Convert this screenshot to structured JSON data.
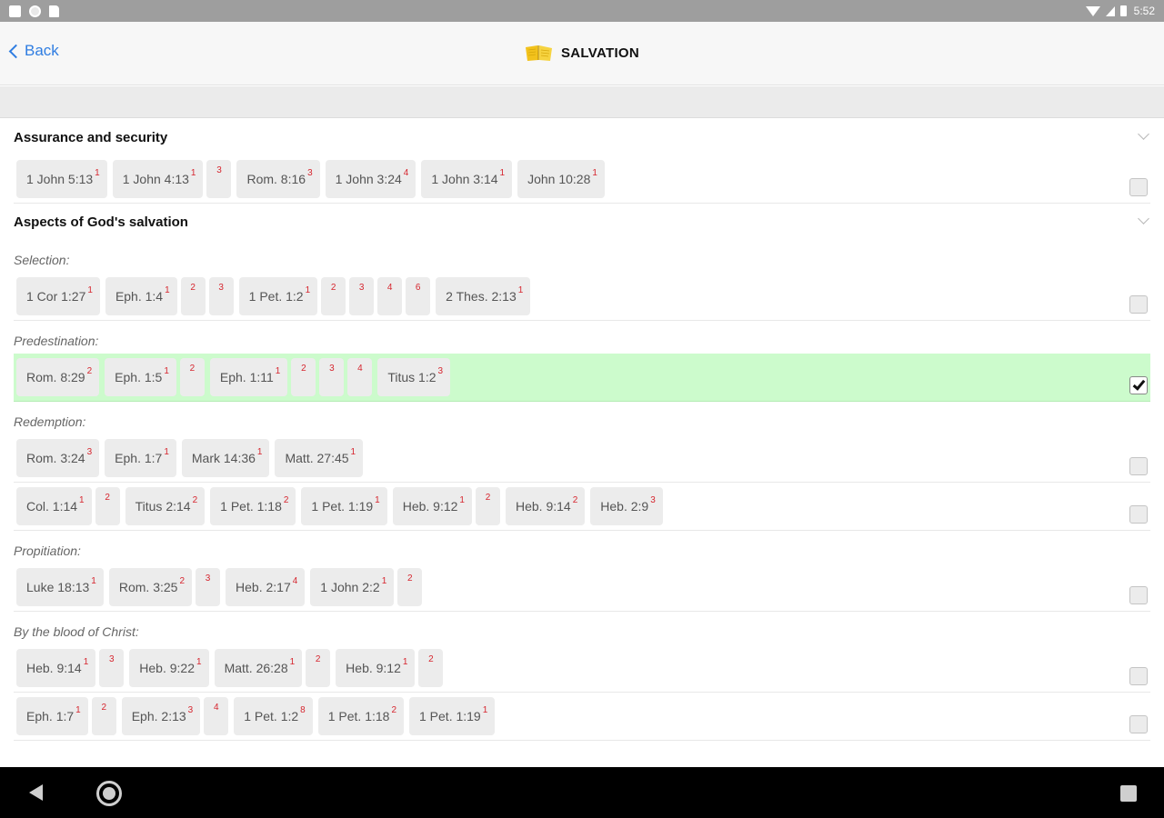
{
  "status_bar": {
    "time": "5:52"
  },
  "header": {
    "back_label": "Back",
    "title": "SALVATION"
  },
  "sections": [
    {
      "title": "Assurance and security",
      "groups": [
        {
          "label": "",
          "rows": [
            {
              "selected": false,
              "refs": [
                {
                  "ref": "1 John 5:13",
                  "sups": [
                    "1"
                  ]
                },
                {
                  "ref": "1 John 4:13",
                  "sups": [
                    "1",
                    "3"
                  ]
                },
                {
                  "ref": "Rom. 8:16",
                  "sups": [
                    "3"
                  ]
                },
                {
                  "ref": "1 John 3:24",
                  "sups": [
                    "4"
                  ]
                },
                {
                  "ref": "1 John 3:14",
                  "sups": [
                    "1"
                  ]
                },
                {
                  "ref": "John 10:28",
                  "sups": [
                    "1"
                  ]
                }
              ]
            }
          ]
        }
      ]
    },
    {
      "title": "Aspects of God's salvation",
      "groups": [
        {
          "label": "Selection:",
          "rows": [
            {
              "selected": false,
              "refs": [
                {
                  "ref": "1 Cor 1:27",
                  "sups": [
                    "1"
                  ]
                },
                {
                  "ref": "Eph. 1:4",
                  "sups": [
                    "1",
                    "2",
                    "3"
                  ]
                },
                {
                  "ref": "1 Pet. 1:2",
                  "sups": [
                    "1",
                    "2",
                    "3",
                    "4",
                    "6"
                  ]
                },
                {
                  "ref": "2 Thes. 2:13",
                  "sups": [
                    "1"
                  ]
                }
              ]
            }
          ]
        },
        {
          "label": "Predestination:",
          "rows": [
            {
              "selected": true,
              "refs": [
                {
                  "ref": "Rom. 8:29",
                  "sups": [
                    "2"
                  ]
                },
                {
                  "ref": "Eph. 1:5",
                  "sups": [
                    "1",
                    "2"
                  ]
                },
                {
                  "ref": "Eph. 1:11",
                  "sups": [
                    "1",
                    "2",
                    "3",
                    "4"
                  ]
                },
                {
                  "ref": "Titus 1:2",
                  "sups": [
                    "3"
                  ]
                }
              ]
            }
          ]
        },
        {
          "label": "Redemption:",
          "rows": [
            {
              "selected": false,
              "refs": [
                {
                  "ref": "Rom. 3:24",
                  "sups": [
                    "3"
                  ]
                },
                {
                  "ref": "Eph. 1:7",
                  "sups": [
                    "1"
                  ]
                },
                {
                  "ref": "Mark 14:36",
                  "sups": [
                    "1"
                  ]
                },
                {
                  "ref": "Matt. 27:45",
                  "sups": [
                    "1"
                  ]
                }
              ]
            },
            {
              "selected": false,
              "refs": [
                {
                  "ref": "Col. 1:14",
                  "sups": [
                    "1",
                    "2"
                  ]
                },
                {
                  "ref": "Titus 2:14",
                  "sups": [
                    "2"
                  ]
                },
                {
                  "ref": "1 Pet. 1:18",
                  "sups": [
                    "2"
                  ]
                },
                {
                  "ref": "1 Pet. 1:19",
                  "sups": [
                    "1"
                  ]
                },
                {
                  "ref": "Heb. 9:12",
                  "sups": [
                    "1",
                    "2"
                  ]
                },
                {
                  "ref": "Heb. 9:14",
                  "sups": [
                    "2"
                  ]
                },
                {
                  "ref": "Heb. 2:9",
                  "sups": [
                    "3"
                  ]
                }
              ]
            }
          ]
        },
        {
          "label": "Propitiation:",
          "rows": [
            {
              "selected": false,
              "refs": [
                {
                  "ref": "Luke 18:13",
                  "sups": [
                    "1"
                  ]
                },
                {
                  "ref": "Rom. 3:25",
                  "sups": [
                    "2",
                    "3"
                  ]
                },
                {
                  "ref": "Heb. 2:17",
                  "sups": [
                    "4"
                  ]
                },
                {
                  "ref": "1 John 2:2",
                  "sups": [
                    "1",
                    "2"
                  ]
                }
              ]
            }
          ]
        },
        {
          "label": "By the blood of Christ:",
          "rows": [
            {
              "selected": false,
              "refs": [
                {
                  "ref": "Heb. 9:14",
                  "sups": [
                    "1",
                    "3"
                  ]
                },
                {
                  "ref": "Heb. 9:22",
                  "sups": [
                    "1"
                  ]
                },
                {
                  "ref": "Matt. 26:28",
                  "sups": [
                    "1",
                    "2"
                  ]
                },
                {
                  "ref": "Heb. 9:12",
                  "sups": [
                    "1",
                    "2"
                  ]
                }
              ]
            },
            {
              "selected": false,
              "refs": [
                {
                  "ref": "Eph. 1:7",
                  "sups": [
                    "1",
                    "2"
                  ]
                },
                {
                  "ref": "Eph. 2:13",
                  "sups": [
                    "3",
                    "4"
                  ]
                },
                {
                  "ref": "1 Pet. 1:2",
                  "sups": [
                    "8"
                  ]
                },
                {
                  "ref": "1 Pet. 1:18",
                  "sups": [
                    "2"
                  ]
                },
                {
                  "ref": "1 Pet. 1:19",
                  "sups": [
                    "1"
                  ]
                }
              ]
            }
          ]
        }
      ]
    }
  ],
  "icons": {
    "back": "chevron-left-icon",
    "title": "book-icon",
    "collapse": "chevron-down-icon",
    "nav_back": "triangle-back-icon",
    "nav_home": "circle-home-icon",
    "nav_recent": "square-recent-icon"
  },
  "colors": {
    "accent": "#2f7de1",
    "selected_row": "#ccfbcc",
    "superscript": "#d6262f",
    "chip_bg": "#ececec"
  }
}
